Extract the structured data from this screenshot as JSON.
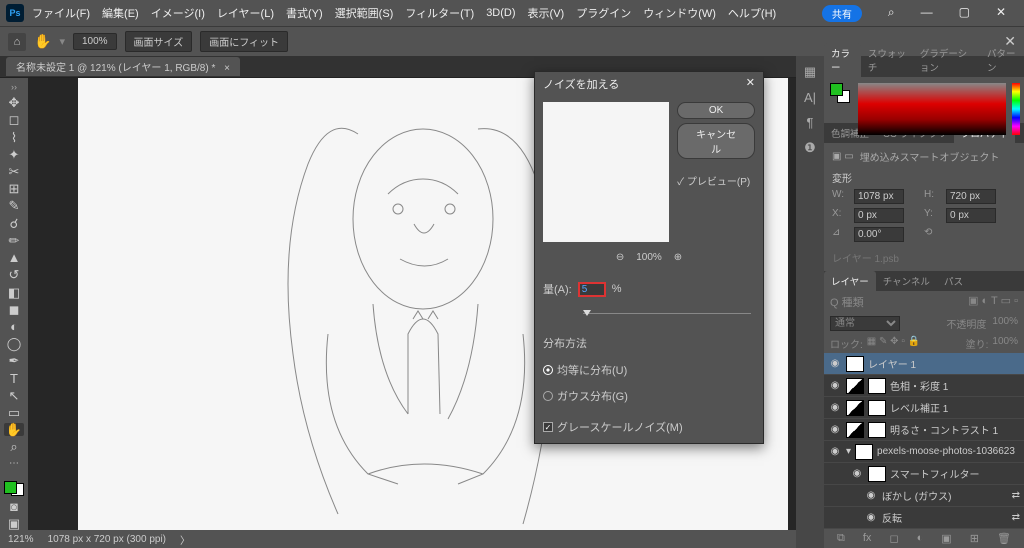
{
  "menu": {
    "items": [
      "ファイル(F)",
      "編集(E)",
      "イメージ(I)",
      "レイヤー(L)",
      "書式(Y)",
      "選択範囲(S)",
      "フィルター(T)",
      "3D(D)",
      "表示(V)",
      "プラグイン",
      "ウィンドウ(W)",
      "ヘルプ(H)"
    ],
    "share": "共有"
  },
  "optbar": {
    "zoom": "100%",
    "fit1": "画面サイズ",
    "fit2": "画面にフィット"
  },
  "tab": {
    "title": "名称未設定 1 @ 121% (レイヤー 1, RGB/8) *"
  },
  "status": {
    "zoom": "121%",
    "dims": "1078 px x 720 px (300 ppi)"
  },
  "color_tabs": [
    "カラー",
    "スウォッチ",
    "グラデーション",
    "パターン"
  ],
  "prop_tabs": [
    "色調補正",
    "CC ライブラリ",
    "プロパティ"
  ],
  "prop": {
    "header": "埋め込みスマートオブジェクト",
    "section": "変形",
    "W": "1078 px",
    "H": "720 px",
    "X": "0 px",
    "Y": "0 px",
    "angle": "0.00°",
    "link": "レイヤー 1.psb"
  },
  "layer_tabs": [
    "レイヤー",
    "チャンネル",
    "パス"
  ],
  "layers": {
    "search": "Q 種類",
    "blend": "通常",
    "opacity_label": "不透明度",
    "opacity": "100%",
    "lock_label": "ロック:",
    "fill_label": "塗り:",
    "fill": "100%",
    "items": [
      {
        "name": "レイヤー 1",
        "sel": true
      },
      {
        "name": "色相・彩度 1",
        "adj": true
      },
      {
        "name": "レベル補正 1",
        "adj": true
      },
      {
        "name": "明るさ・コントラスト 1",
        "adj": true
      },
      {
        "name": "pexels-moose-photos-1036623",
        "smart": true
      }
    ],
    "smart_label": "スマートフィルター",
    "filter1": "ぼかし (ガウス)",
    "filter2": "反転"
  },
  "dialog": {
    "title": "ノイズを加える",
    "ok": "OK",
    "cancel": "キャンセル",
    "preview": "プレビュー(P)",
    "preview_zoom": "100%",
    "amount_label": "量(A):",
    "amount_value": "5",
    "amount_unit": "%",
    "dist_label": "分布方法",
    "uniform": "均等に分布(U)",
    "gaussian": "ガウス分布(G)",
    "mono": "グレースケールノイズ(M)"
  }
}
